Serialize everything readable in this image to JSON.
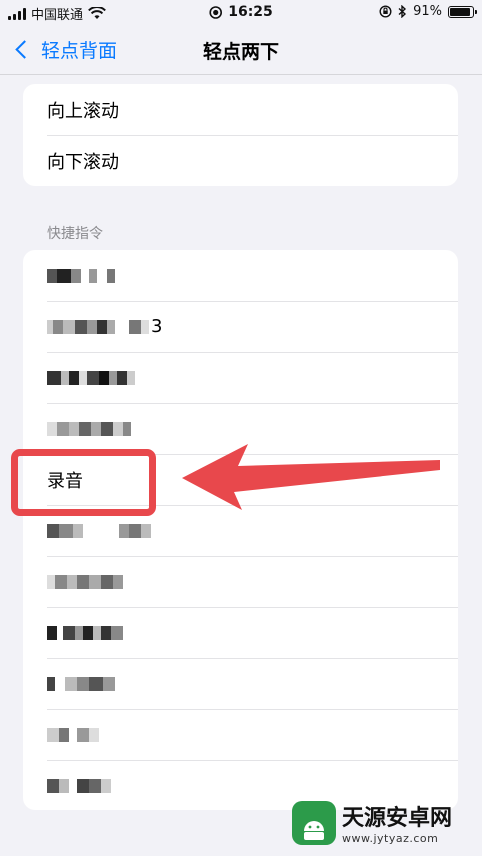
{
  "status_bar": {
    "carrier": "中国联通",
    "time": "16:25",
    "battery_percent": "91%",
    "battery_level": 0.91
  },
  "nav": {
    "back_label": "轻点背面",
    "title": "轻点两下"
  },
  "scroll_group": {
    "items": [
      "向上滚动",
      "向下滚动"
    ]
  },
  "shortcuts": {
    "header": "快捷指令",
    "row2_suffix": "3",
    "recording": "录音"
  },
  "watermark": {
    "name": "天源安卓网",
    "url": "www.jytyaz.com"
  },
  "colors": {
    "accent": "#0a7aff",
    "highlight": "#e8484c"
  }
}
